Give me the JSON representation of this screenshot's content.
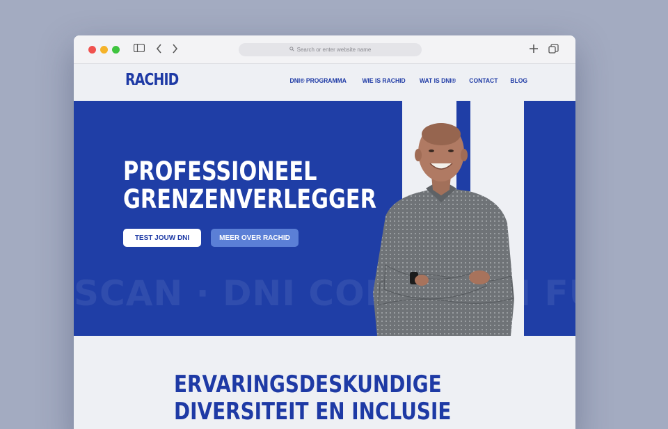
{
  "browser": {
    "address_placeholder": "Search or enter website name"
  },
  "site": {
    "logo": "RACHID",
    "nav": [
      "DNI® PROGRAMMA",
      "WIE IS RACHID",
      "WAT IS DNI®",
      "CONTACT",
      "BLOG"
    ]
  },
  "hero": {
    "title_line1": "PROFESSIONEEL",
    "title_line2": "GRENZENVERLEGGER",
    "primary_button": "TEST JOUW DNI",
    "secondary_button": "MEER OVER RACHID",
    "marquee": "SCAN · DNI CODE · DNI FUTURE"
  },
  "section": {
    "title_line1": "ERVARINGSDESKUNDIGE",
    "title_line2": "DIVERSITEIT EN INCLUSIE"
  },
  "colors": {
    "brand_blue": "#1f3ea6",
    "secondary_button": "#5b7fd6",
    "background": "#a3abc1"
  }
}
